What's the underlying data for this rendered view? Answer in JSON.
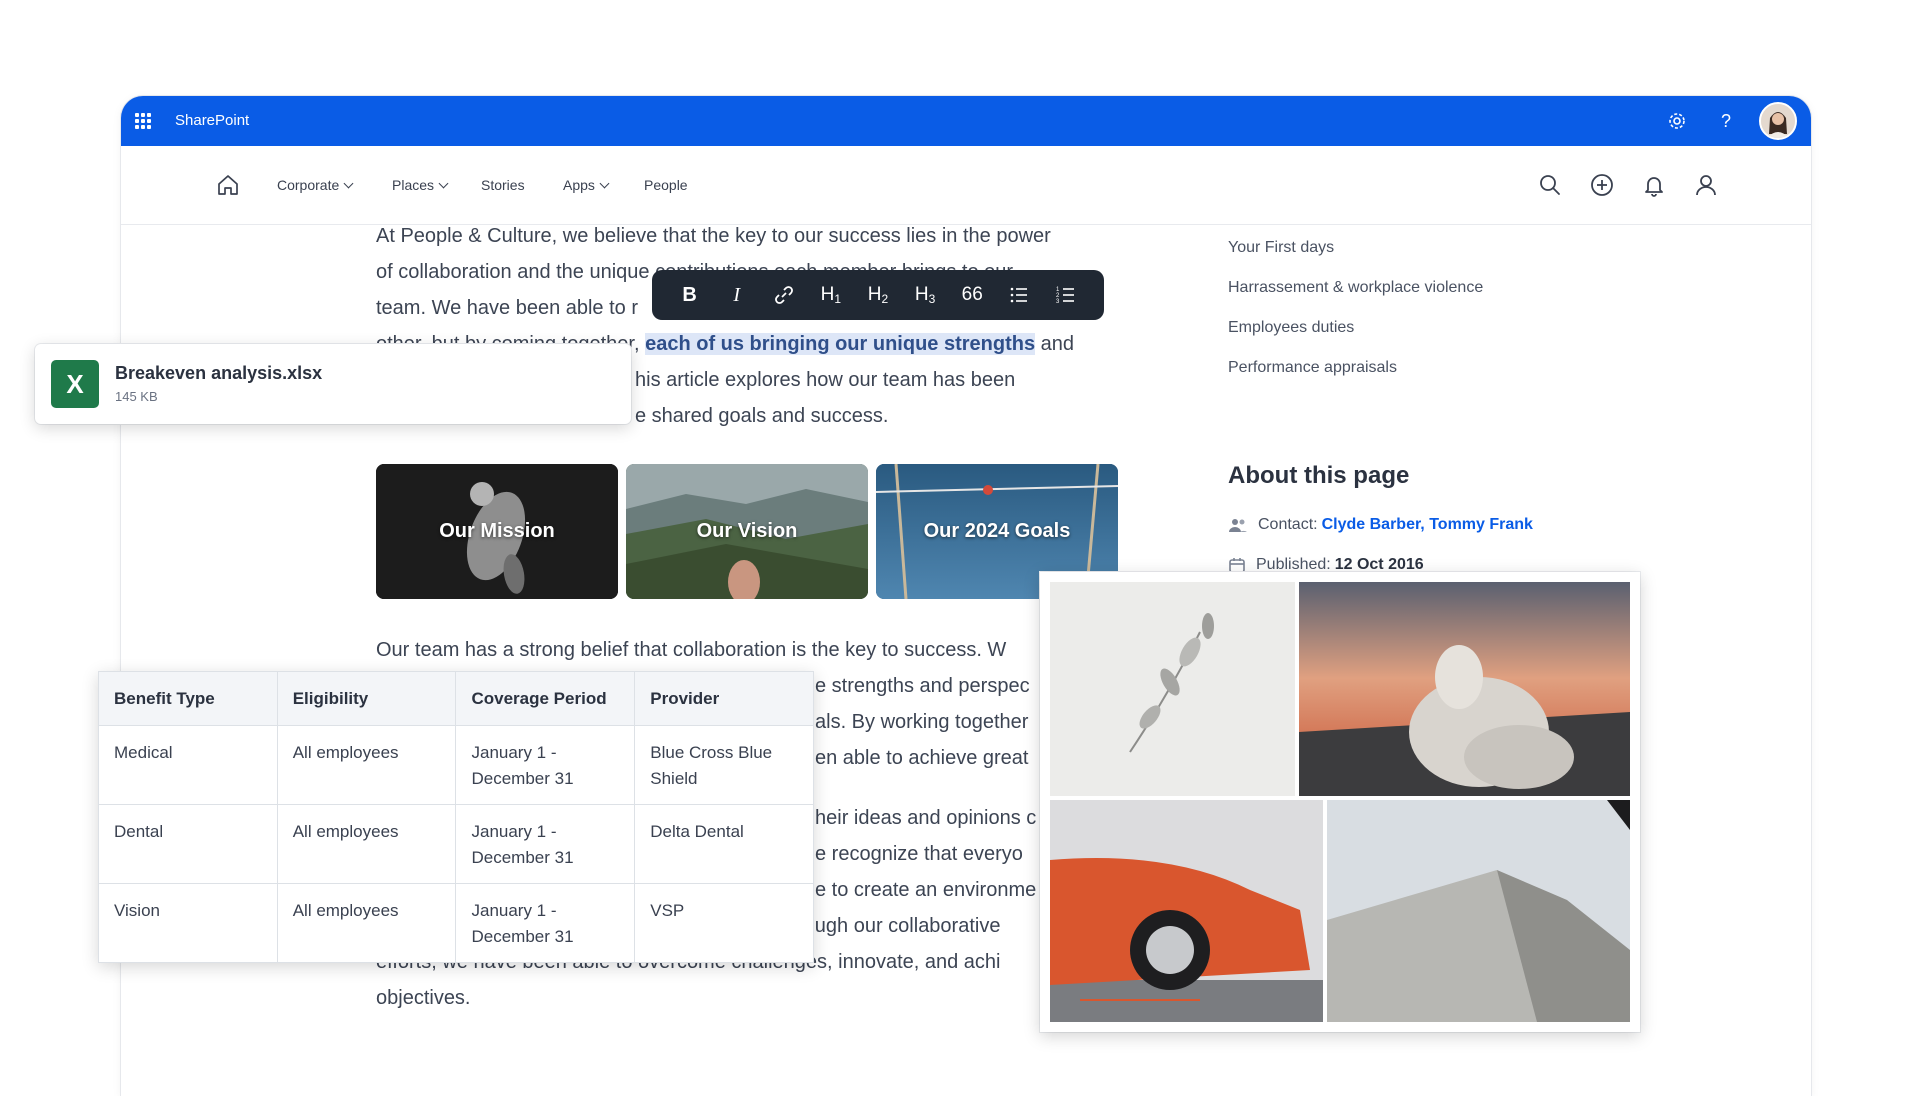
{
  "topbar": {
    "brand": "SharePoint",
    "icons": [
      "app-launcher-icon",
      "settings-icon",
      "help-icon",
      "user-avatar"
    ]
  },
  "nav": {
    "items": [
      {
        "label": "Corporate",
        "dropdown": true
      },
      {
        "label": "Places",
        "dropdown": true
      },
      {
        "label": "Stories",
        "dropdown": false
      },
      {
        "label": "Apps",
        "dropdown": true
      },
      {
        "label": "People",
        "dropdown": false
      }
    ],
    "right_icons": [
      "search-icon",
      "add-circle-icon",
      "bell-icon",
      "person-icon"
    ]
  },
  "toolbar": {
    "bold": "B",
    "italic": "I",
    "h1": "H",
    "h1_sub": "1",
    "h2": "H",
    "h2_sub": "2",
    "h3": "H",
    "h3_sub": "3",
    "quote": "66"
  },
  "article": {
    "intro_lines": [
      "At People & Culture, we believe that the key to our success lies in the power",
      "of collaboration and the unique contributions each member brings to our",
      "team. We have been able to r",
      "other, but by coming together,",
      "each of us bringing our unique strengths",
      "and",
      "his article explores how our team has been",
      "e shared goals and success."
    ],
    "cards": [
      "Our Mission",
      "Our Vision",
      "Our 2024 Goals"
    ],
    "body_lines": [
      "Our team has a strong belief that collaboration is the key to success. W",
      "e strengths and perspec",
      "als. By working together",
      "en able to achieve great",
      "heir ideas and opinions c",
      "e recognize that everyo",
      "e to create an environme",
      "where everyone feels valued and respected. Through our collaborative",
      "efforts, we have been able to overcome challenges, innovate, and achi",
      "objectives."
    ]
  },
  "sidebar": {
    "links": [
      "Your First days",
      "Harrassement & workplace violence",
      "Employees duties",
      "Performance appraisals"
    ],
    "about_title": "About this page",
    "contact_label": "Contact:",
    "contact_1": "Clyde Barber,",
    "contact_2": "Tommy Frank",
    "published_label": "Published:",
    "published_date": "12 Oct 2016"
  },
  "file": {
    "icon_letter": "X",
    "name": "Breakeven analysis.xlsx",
    "size": "145 KB"
  },
  "benefits_table": {
    "headers": [
      "Benefit Type",
      "Eligibility",
      "Coverage Period",
      "Provider"
    ],
    "rows": [
      {
        "type": "Medical",
        "eligibility": "All employees",
        "period_1": "January 1 -",
        "period_2": "December 31",
        "provider_1": "Blue Cross Blue",
        "provider_2": "Shield"
      },
      {
        "type": "Dental",
        "eligibility": "All employees",
        "period_1": "January 1 -",
        "period_2": "December 31",
        "provider_1": "Delta Dental",
        "provider_2": ""
      },
      {
        "type": "Vision",
        "eligibility": "All employees",
        "period_1": "January 1 -",
        "period_2": "December 31",
        "provider_1": "VSP",
        "provider_2": ""
      }
    ]
  },
  "colors": {
    "brand_blue": "#0a5ce6",
    "toolbar_bg": "#202833",
    "excel_green": "#1f7a4a",
    "highlight": "#dde6f7"
  }
}
